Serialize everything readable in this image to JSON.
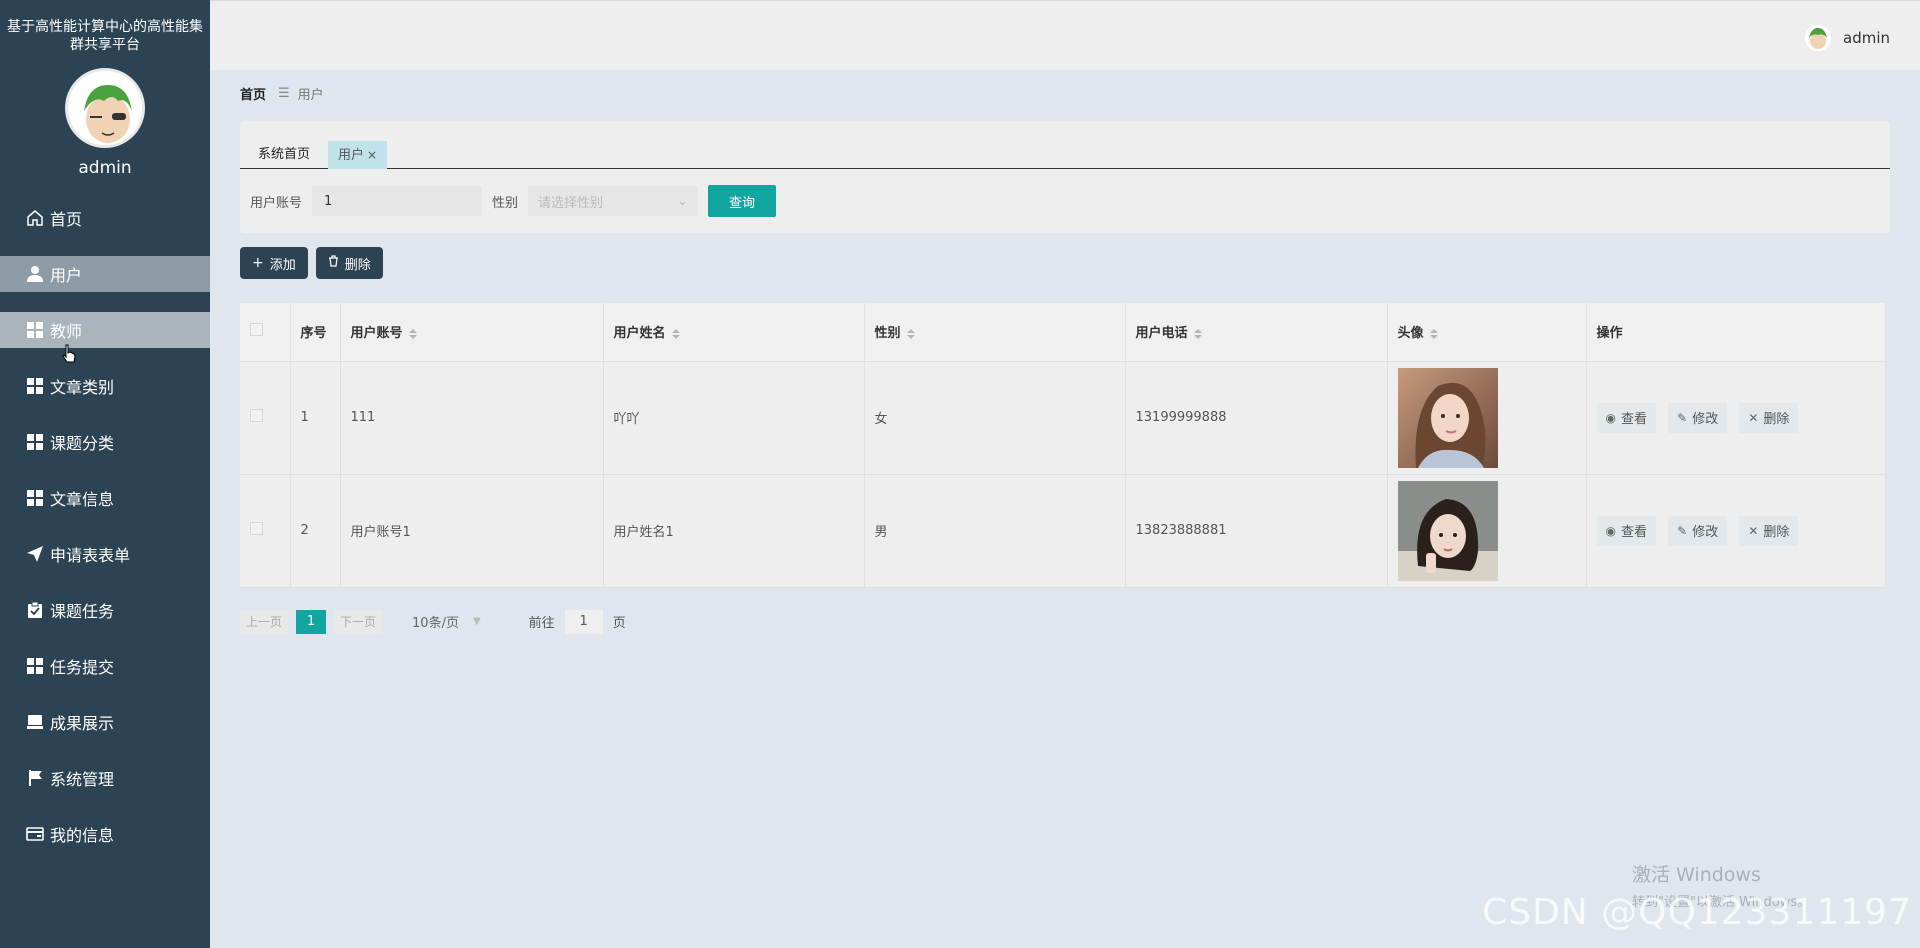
{
  "sidebar": {
    "system_title": "基于高性能计算中心的高性能集群共享平台",
    "username": "admin",
    "items": [
      {
        "label": "首页",
        "icon": "home-icon"
      },
      {
        "label": "用户",
        "icon": "user-icon"
      },
      {
        "label": "教师",
        "icon": "grid-icon"
      },
      {
        "label": "文章类别",
        "icon": "grid-icon"
      },
      {
        "label": "课题分类",
        "icon": "grid-icon"
      },
      {
        "label": "文章信息",
        "icon": "grid-icon"
      },
      {
        "label": "申请表表单",
        "icon": "send-icon"
      },
      {
        "label": "课题任务",
        "icon": "clipboard-icon"
      },
      {
        "label": "任务提交",
        "icon": "grid-icon"
      },
      {
        "label": "成果展示",
        "icon": "monitor-icon"
      },
      {
        "label": "系统管理",
        "icon": "flag-icon"
      },
      {
        "label": "我的信息",
        "icon": "card-icon"
      }
    ]
  },
  "topbar": {
    "username": "admin"
  },
  "breadcrumb": {
    "home": "首页",
    "current": "用户"
  },
  "tabs": [
    {
      "label": "系统首页"
    },
    {
      "label": "用户",
      "close": "×"
    }
  ],
  "search": {
    "account_label": "用户账号",
    "account_value": "1",
    "gender_label": "性别",
    "gender_placeholder": "请选择性别",
    "query_label": "查询"
  },
  "actions": {
    "add_label": "添加",
    "delete_label": "删除"
  },
  "table": {
    "headers": {
      "index": "序号",
      "account": "用户账号",
      "name": "用户姓名",
      "gender": "性别",
      "phone": "用户电话",
      "avatar": "头像",
      "ops": "操作"
    },
    "rows": [
      {
        "index": "1",
        "account": "111",
        "name": "吖吖",
        "gender": "女",
        "phone": "13199999888"
      },
      {
        "index": "2",
        "account": "用户账号1",
        "name": "用户姓名1",
        "gender": "男",
        "phone": "13823888881"
      }
    ],
    "ops": {
      "view": "查看",
      "edit": "修改",
      "delete": "删除"
    }
  },
  "pager": {
    "prev": "上一页",
    "current": "1",
    "next": "下一页",
    "size": "10条/页",
    "goto_prefix": "前往",
    "goto_value": "1",
    "goto_suffix": "页"
  },
  "watermark": {
    "win_line1": "激活 Windows",
    "win_line2": "转到\"设置\"以激活 Windows。",
    "csdn": "CSDN @QQ123311197"
  },
  "colors": {
    "sidebar": "#2c4353",
    "accent": "#13a6a0",
    "active_item": "#8c9ba5"
  }
}
